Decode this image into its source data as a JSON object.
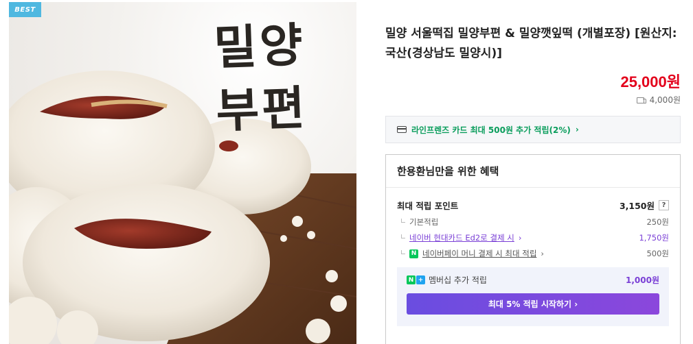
{
  "image": {
    "badge": "BEST",
    "calligraphy_line1": "밀양",
    "calligraphy_line2": "부편"
  },
  "product": {
    "title": "밀양 서울떡집 밀양부편 & 밀양깻잎떡 (개별포장) [원산지:국산(경상남도 밀양시)]",
    "price": "25,000원",
    "shipping": "4,000원",
    "shipping_icon": "truck-icon"
  },
  "card_banner": {
    "icon": "credit-card-icon",
    "text": "라인프렌즈 카드 최대 500원 추가 적립(2%)",
    "chevron": "›"
  },
  "benefits": {
    "title": "한용환님만을 위한 혜택",
    "max_points_label": "최대 적립 포인트",
    "max_points_value": "3,150원",
    "help": "?",
    "rows": [
      {
        "label": "기본적립",
        "value": "250원"
      },
      {
        "label": "네이버 현대카드 Ed2로 결제 시",
        "value": "1,750원"
      },
      {
        "label": "네이버페이 머니 결제 시 최대 적립",
        "value": "500원",
        "badge": "N"
      }
    ],
    "membership": {
      "badge_n": "N",
      "badge_plus": "+",
      "label": "멤버십 추가 적립",
      "value": "1,000원",
      "cta": "최대 5% 적립 시작하기 ›"
    }
  },
  "colors": {
    "price": "#e3001b",
    "accent_green": "#0a9d5c",
    "accent_purple": "#7a3fd6",
    "badge_blue": "#4fb8e0"
  }
}
